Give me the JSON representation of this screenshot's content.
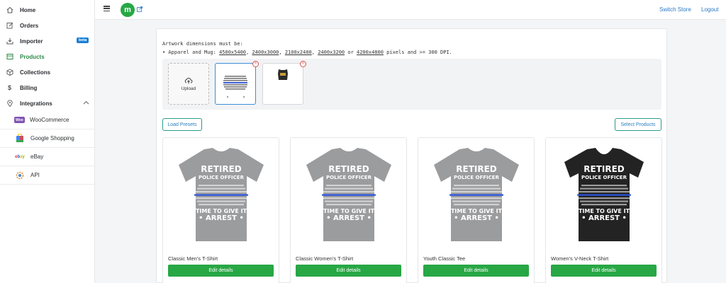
{
  "sidebar": {
    "items": [
      {
        "label": "Home",
        "icon": "home-icon"
      },
      {
        "label": "Orders",
        "icon": "edit-icon"
      },
      {
        "label": "Importer",
        "icon": "import-icon",
        "badge": "beta"
      },
      {
        "label": "Products",
        "icon": "products-icon",
        "active": true
      },
      {
        "label": "Collections",
        "icon": "box-icon"
      },
      {
        "label": "Billing",
        "icon": "dollar-icon"
      },
      {
        "label": "Integrations",
        "icon": "location-pin-icon"
      }
    ],
    "integrations": [
      {
        "label": "WooCommerce",
        "logo": "woo"
      },
      {
        "label": "Google Shopping",
        "logo": "google-shopping"
      },
      {
        "label": "eBay",
        "logo": "ebay"
      },
      {
        "label": "API",
        "logo": "api"
      }
    ]
  },
  "topbar": {
    "brand_letter": "m",
    "switch_store": "Switch Store",
    "logout": "Logout"
  },
  "artwork": {
    "line1": "Artwork dimensions must be:",
    "line2_prefix": "• Apparel and Mug: ",
    "sizes": [
      "4500x5400",
      "2400x3000",
      "2100x2400",
      "2400x3200",
      "4200x4800"
    ],
    "sep1": ", ",
    "or_text": " or ",
    "line2_suffix": " pixels and >= 300 DPI.",
    "upload_label": "Upload"
  },
  "actions": {
    "load_presets": "Load Presets",
    "select_products": "Select Products"
  },
  "products": [
    {
      "name": "Classic Men's T-Shirt",
      "button": "Edit details",
      "color": "#9b9c9e"
    },
    {
      "name": "Classic Women's T-Shirt",
      "button": "Edit details",
      "color": "#9b9c9e"
    },
    {
      "name": "Youth Classic Tee",
      "button": "Edit details",
      "color": "#9b9c9e"
    },
    {
      "name": "Women's V-Neck T-Shirt",
      "button": "Edit details",
      "color": "#232323"
    }
  ],
  "design_text": {
    "line1": "RETIRED",
    "line2": "POLICE OFFICER",
    "line3": "TIME TO GIVE IT",
    "line4": "• ARREST •"
  },
  "colors": {
    "accent_green": "#28a745",
    "link_blue": "#2a78c7",
    "beta_blue": "#1a7fd6"
  }
}
